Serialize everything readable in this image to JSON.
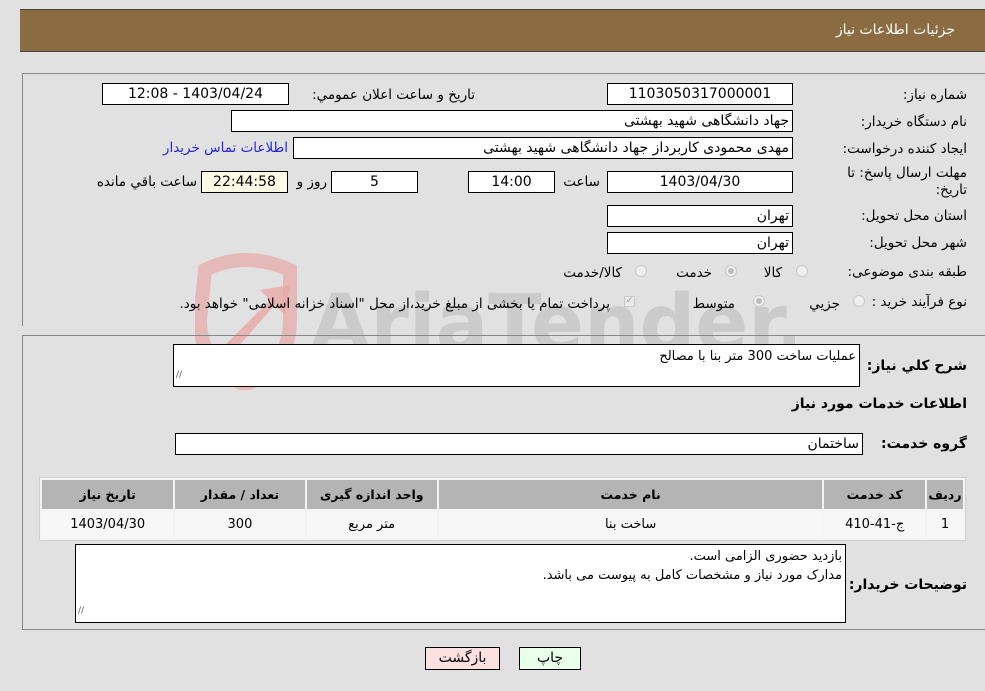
{
  "header": {
    "title": "جزئيات اطلاعات نياز"
  },
  "fields": {
    "need_number_label": "شماره نياز:",
    "need_number": "1103050317000001",
    "announce_label": "تاريخ و ساعت اعلان عمومي:",
    "announce_value": "1403/04/24 - 12:08",
    "buyer_org_label": "نام دستگاه خريدار:",
    "buyer_org": "جهاد دانشگاهی شهید بهشتی",
    "requester_label": "ايجاد کننده درخواست:",
    "requester": "مهدی محمودی کاربرداز جهاد دانشگاهی شهید بهشتی",
    "contact_link": "اطلاعات تماس خريدار",
    "deadline_label": "مهلت ارسال پاسخ: تا تاريخ:",
    "deadline_date": "1403/04/30",
    "time_label": "ساعت",
    "deadline_time": "14:00",
    "days_value": "5",
    "days_label": "روز و",
    "remaining_time": "22:44:58",
    "remaining_label": "ساعت باقي مانده",
    "province_label": "استان محل تحويل:",
    "province": "تهران",
    "city_label": "شهر محل تحويل:",
    "city": "تهران",
    "category_label": "طبقه بندی موضوعی:",
    "category_options": [
      "کالا",
      "خدمت",
      "کالا/خدمت"
    ],
    "category_selected": "خدمت",
    "process_label": "نوع فرآيند خريد :",
    "process_options": [
      "جزيي",
      "متوسط"
    ],
    "process_selected": "متوسط",
    "treasury_text": "پرداخت تمام يا بخشی از مبلغ خريد،از محل \"اسناد خزانه اسلامی\" خواهد بود.",
    "treasury_checked": true
  },
  "details": {
    "summary_label": "شرح کلي نياز:",
    "summary": "عمليات ساخت 300 متر بنا با مصالح",
    "services_heading": "اطلاعات خدمات مورد نياز",
    "service_group_label": "گروه خدمت:",
    "service_group": "ساختمان",
    "table": {
      "headers": [
        "رديف",
        "کد خدمت",
        "نام خدمت",
        "واحد اندازه گيری",
        "تعداد / مقدار",
        "تاريخ نياز"
      ],
      "rows": [
        [
          "1",
          "ج-41-410",
          "ساخت بنا",
          "متر مربع",
          "300",
          "1403/04/30"
        ]
      ]
    },
    "buyer_notes_label": "توضيحات خريدار:",
    "buyer_notes_line1": "بازدید حضوری الزامی است.",
    "buyer_notes_line2": "مدارک مورد نیاز و مشخصات کامل به پیوست می باشد."
  },
  "buttons": {
    "print": "چاپ",
    "back": "بازگشت"
  },
  "watermark": {
    "text": "AriaTender.neT"
  },
  "colors": {
    "header_bg": "#8b6c42",
    "link": "#2626d6",
    "back_btn": "#fde0e0",
    "print_btn": "#eaffea",
    "remaining_bg": "#fdfbe6"
  }
}
